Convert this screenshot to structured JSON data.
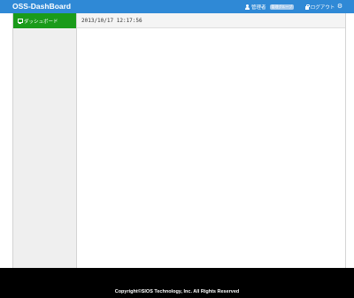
{
  "app": {
    "title": "OSS-DashBoard"
  },
  "navbar": {
    "user": {
      "icon": "user-icon",
      "label": "管理者",
      "badge": "管理グループ"
    },
    "logout": {
      "icon": "lock-icon",
      "label": "ログアウト"
    },
    "settings": {
      "icon": "gear-icon",
      "glyph": "⚙"
    }
  },
  "sidebar": {
    "items": [
      {
        "icon": "monitor-icon",
        "label": "ダッシュボード",
        "active": true
      }
    ]
  },
  "main": {
    "datetime": "2013/10/17 12:17:56"
  },
  "footer": {
    "copyright": "Copyright©SIOS Technology, Inc. All Rights Reserved"
  },
  "colors": {
    "navbar": "#2f89d6",
    "sidebar_active": "#1a9b1a",
    "sidebar_bg": "#efefef",
    "footer": "#000000",
    "badge": "#a9cbec"
  }
}
